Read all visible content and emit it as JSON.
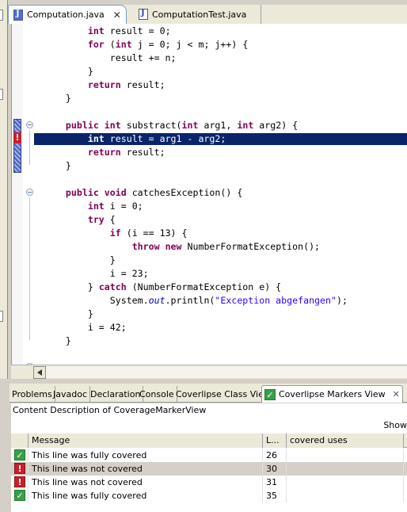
{
  "editor_tabs": [
    {
      "label": "Computation.java",
      "active": true
    },
    {
      "label": "ComputationTest.java",
      "active": false
    }
  ],
  "code": {
    "lines": [
      {
        "parts": [
          {
            "t": "        "
          },
          {
            "t": "int",
            "k": "kw"
          },
          {
            "t": " result = 0;"
          }
        ]
      },
      {
        "parts": [
          {
            "t": "        "
          },
          {
            "t": "for",
            "k": "kw"
          },
          {
            "t": " ("
          },
          {
            "t": "int",
            "k": "kw"
          },
          {
            "t": " j = 0; j < m; j++) {"
          }
        ]
      },
      {
        "parts": [
          {
            "t": "            result += n;"
          }
        ]
      },
      {
        "parts": [
          {
            "t": "        }"
          }
        ]
      },
      {
        "parts": [
          {
            "t": "        "
          },
          {
            "t": "return",
            "k": "kw"
          },
          {
            "t": " result;"
          }
        ]
      },
      {
        "parts": [
          {
            "t": "    }"
          }
        ]
      },
      {
        "parts": [
          {
            "t": ""
          }
        ]
      },
      {
        "parts": [
          {
            "t": "    "
          },
          {
            "t": "public",
            "k": "kw"
          },
          {
            "t": " "
          },
          {
            "t": "int",
            "k": "kw"
          },
          {
            "t": " substract("
          },
          {
            "t": "int",
            "k": "kw"
          },
          {
            "t": " arg1, "
          },
          {
            "t": "int",
            "k": "kw"
          },
          {
            "t": " arg2) {"
          }
        ]
      },
      {
        "parts": [
          {
            "t": "        "
          },
          {
            "t": "int",
            "k": "kw"
          },
          {
            "t": " result = arg1 - arg2;"
          }
        ],
        "highlight": true
      },
      {
        "parts": [
          {
            "t": "        "
          },
          {
            "t": "return",
            "k": "kw"
          },
          {
            "t": " result;"
          }
        ]
      },
      {
        "parts": [
          {
            "t": "    }"
          }
        ]
      },
      {
        "parts": [
          {
            "t": ""
          }
        ]
      },
      {
        "parts": [
          {
            "t": "    "
          },
          {
            "t": "public",
            "k": "kw"
          },
          {
            "t": " "
          },
          {
            "t": "void",
            "k": "kw"
          },
          {
            "t": " catchesException() {"
          }
        ]
      },
      {
        "parts": [
          {
            "t": "        "
          },
          {
            "t": "int",
            "k": "kw"
          },
          {
            "t": " i = 0;"
          }
        ]
      },
      {
        "parts": [
          {
            "t": "        "
          },
          {
            "t": "try",
            "k": "kw"
          },
          {
            "t": " {"
          }
        ]
      },
      {
        "parts": [
          {
            "t": "            "
          },
          {
            "t": "if",
            "k": "kw"
          },
          {
            "t": " (i == 13) {"
          }
        ]
      },
      {
        "parts": [
          {
            "t": "                "
          },
          {
            "t": "throw",
            "k": "kw"
          },
          {
            "t": " "
          },
          {
            "t": "new",
            "k": "kw"
          },
          {
            "t": " NumberFormatException();"
          }
        ]
      },
      {
        "parts": [
          {
            "t": "            }"
          }
        ]
      },
      {
        "parts": [
          {
            "t": "            i = 23;"
          }
        ]
      },
      {
        "parts": [
          {
            "t": "        } "
          },
          {
            "t": "catch",
            "k": "kw"
          },
          {
            "t": " (NumberFormatException e) {"
          }
        ]
      },
      {
        "parts": [
          {
            "t": "            System."
          },
          {
            "t": "out",
            "k": "it"
          },
          {
            "t": ".println("
          },
          {
            "t": "\"Exception abgefangen\"",
            "k": "str"
          },
          {
            "t": ");"
          }
        ]
      },
      {
        "parts": [
          {
            "t": "        }"
          }
        ]
      },
      {
        "parts": [
          {
            "t": "        i = 42;"
          }
        ]
      },
      {
        "parts": [
          {
            "t": "    }"
          }
        ]
      }
    ],
    "error_marker": "!"
  },
  "view_tabs": [
    {
      "label": "Problems"
    },
    {
      "label": "Javadoc"
    },
    {
      "label": "Declaration"
    },
    {
      "label": "Console"
    },
    {
      "label": "Coverlipse Class View"
    },
    {
      "label": "Coverlipse Markers View",
      "active": true
    }
  ],
  "content_description": "Content Description of CoverageMarkerView",
  "show_label": "Show",
  "table": {
    "columns": [
      "Message",
      "L...",
      "covered uses"
    ],
    "rows": [
      {
        "status": "covered",
        "icon": "check-icon",
        "message": "This line was fully covered",
        "line": "26",
        "uses": ""
      },
      {
        "status": "not-covered",
        "icon": "error-icon",
        "message": "This line was not covered",
        "line": "30",
        "uses": "",
        "selected": true
      },
      {
        "status": "not-covered",
        "icon": "error-icon",
        "message": "This line was not covered",
        "line": "31",
        "uses": ""
      },
      {
        "status": "covered",
        "icon": "check-icon",
        "message": "This line was fully covered",
        "line": "35",
        "uses": ""
      }
    ]
  },
  "colors": {
    "keyword": "#7f0055",
    "string": "#2a00ff",
    "selection": "#0a246a",
    "covered": "#37a04a",
    "not_covered": "#c8202a"
  }
}
